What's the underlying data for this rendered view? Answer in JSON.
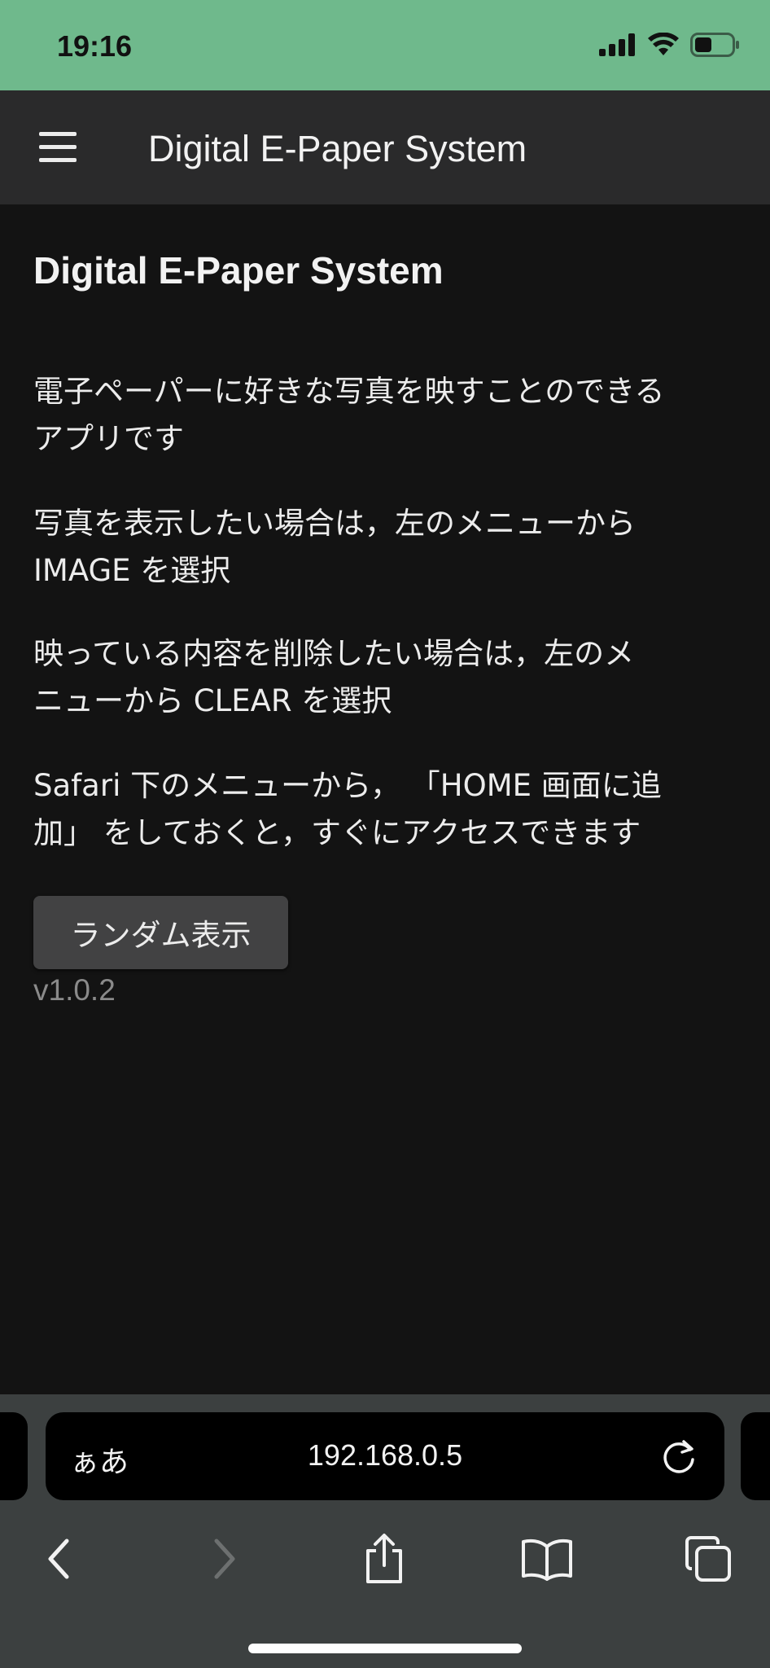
{
  "status_bar": {
    "time": "19:16",
    "icons": [
      "signal-icon",
      "wifi-icon",
      "battery-icon"
    ],
    "background": "#6fb98c"
  },
  "app_bar": {
    "menu_icon": "hamburger-menu-icon",
    "title": "Digital E-Paper System"
  },
  "main": {
    "heading": "Digital E-Paper System",
    "paragraphs": [
      [
        "電子ペーパーに好きな写真を映すことのできる",
        "アプリです"
      ],
      [
        "写真を表示したい場合は，左のメニューから",
        "IMAGE を選択"
      ],
      [
        "映っている内容を削除したい場合は，左のメ",
        "ニューから CLEAR を選択"
      ],
      [
        "Safari 下のメニューから， 「HOME 画面に追",
        "加」 をしておくと，すぐにアクセスできます"
      ]
    ],
    "random_button_label": "ランダム表示",
    "version": "v1.0.2"
  },
  "safari": {
    "aa_label": "ぁあ",
    "url": "192.168.0.5",
    "reload_icon": "reload-icon",
    "toolbar": [
      "back-icon",
      "forward-icon",
      "share-icon",
      "bookmarks-icon",
      "tabs-icon"
    ]
  }
}
